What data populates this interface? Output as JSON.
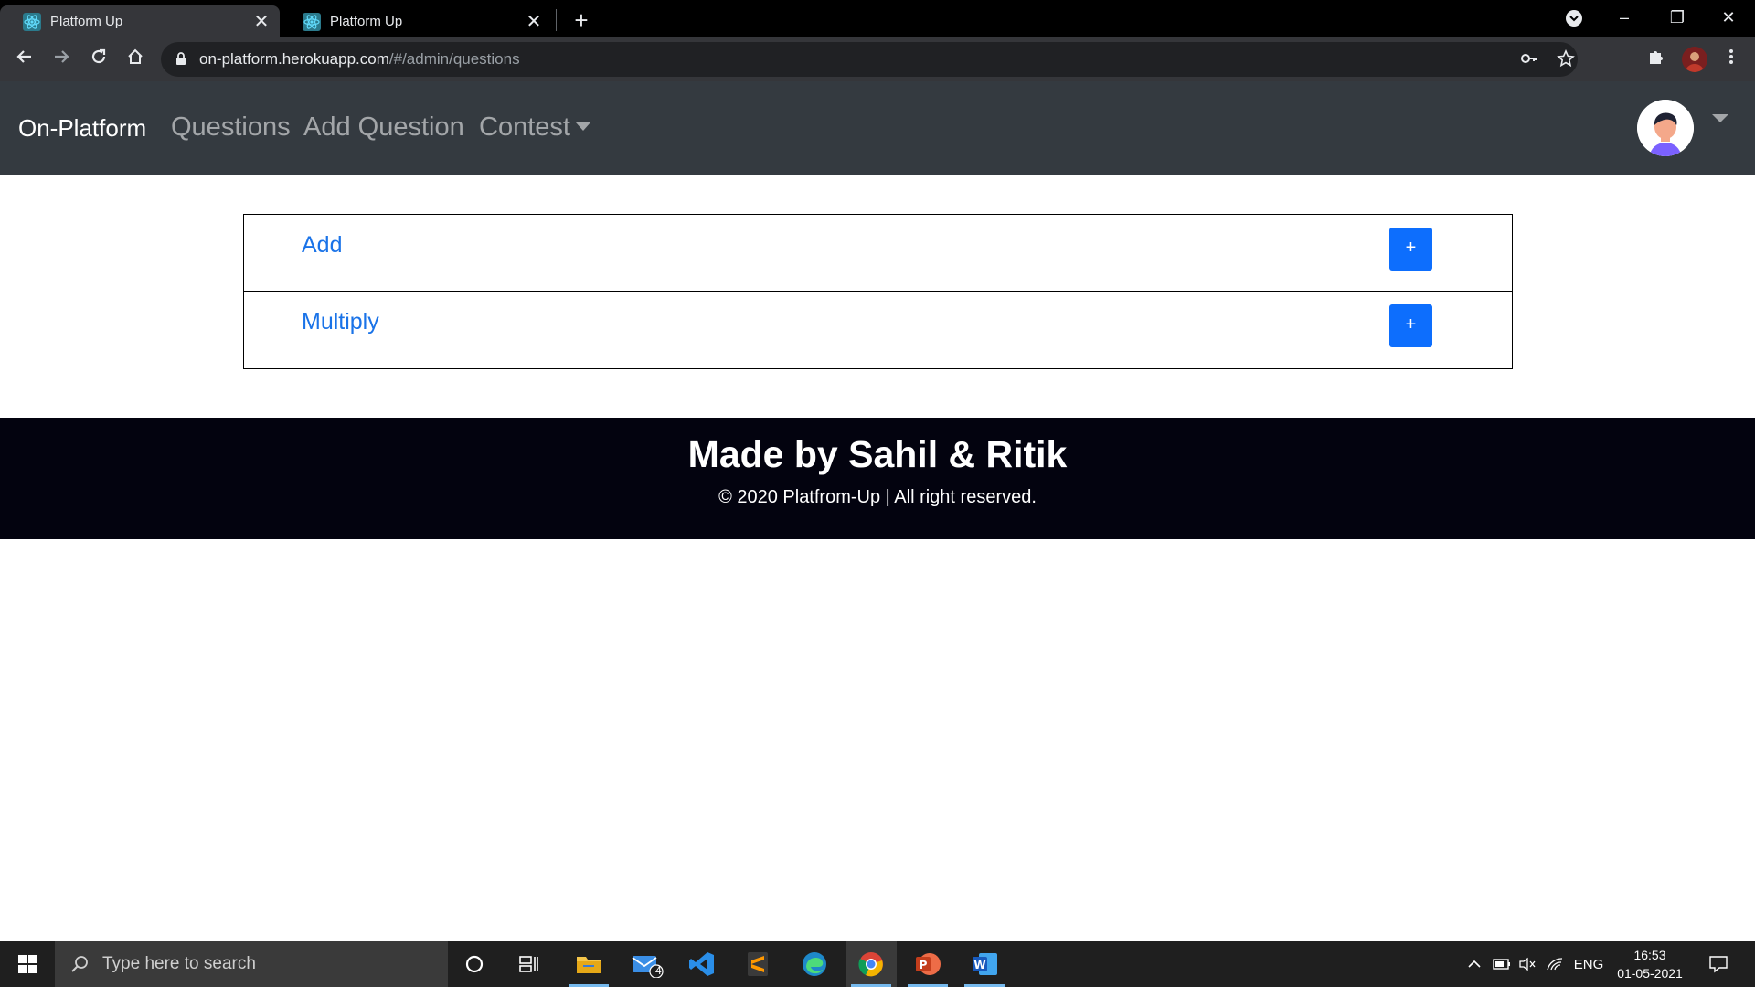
{
  "browser": {
    "tabs": [
      {
        "title": "Platform Up",
        "active": true
      },
      {
        "title": "Platform Up",
        "active": false
      }
    ],
    "new_tab_symbol": "+",
    "close_symbol": "✕",
    "url_host": "on-platform.herokuapp.com",
    "url_path": "/#/admin/questions",
    "window_controls": {
      "minimize": "–",
      "restore": "❐",
      "close": "✕"
    }
  },
  "navbar": {
    "brand": "On-Platform",
    "links": [
      {
        "label": "Questions"
      },
      {
        "label": "Add Question"
      },
      {
        "label": "Contest",
        "dropdown": true
      }
    ]
  },
  "questions": [
    {
      "title": "Add",
      "button_label": "+"
    },
    {
      "title": "Multiply",
      "button_label": "+"
    }
  ],
  "footer": {
    "title": "Made by Sahil & Ritik",
    "copyright": "© 2020 Platfrom-Up | All right reserved."
  },
  "taskbar": {
    "search_placeholder": "Type here to search",
    "mail_badge": "4",
    "language": "ENG",
    "time": "16:53",
    "date": "01-05-2021",
    "apps": [
      "cortana-icon",
      "task-view-icon",
      "file-explorer-icon",
      "mail-icon",
      "vscode-icon",
      "sublime-icon",
      "edge-icon",
      "chrome-icon",
      "powerpoint-icon",
      "word-icon"
    ]
  },
  "colors": {
    "navbar_bg": "#343a40",
    "link_blue": "#1a73e8",
    "button_blue": "#0d6efd",
    "footer_bg": "#03030f"
  }
}
